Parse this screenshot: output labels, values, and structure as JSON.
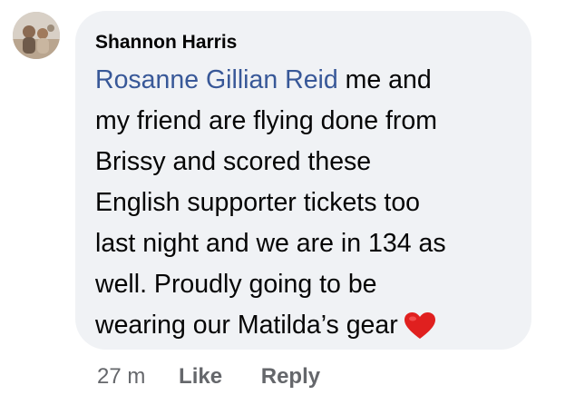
{
  "comment": {
    "author": "Shannon Harris",
    "mention": "Rosanne Gillian Reid",
    "line1_rest": " me and",
    "lines": [
      "my friend are flying done from",
      "Brissy and scored these",
      "English supporter tickets too",
      "last night and we are in 134 as",
      "well. Proudly going to be",
      "wearing our Matilda’s gear"
    ],
    "emoji": "heart-emoji"
  },
  "actions": {
    "time": "27 m",
    "like": "Like",
    "reply": "Reply"
  },
  "colors": {
    "bubble": "#f0f2f5",
    "mention": "#385898",
    "muted": "#65676b",
    "heart": "#e0201f"
  }
}
